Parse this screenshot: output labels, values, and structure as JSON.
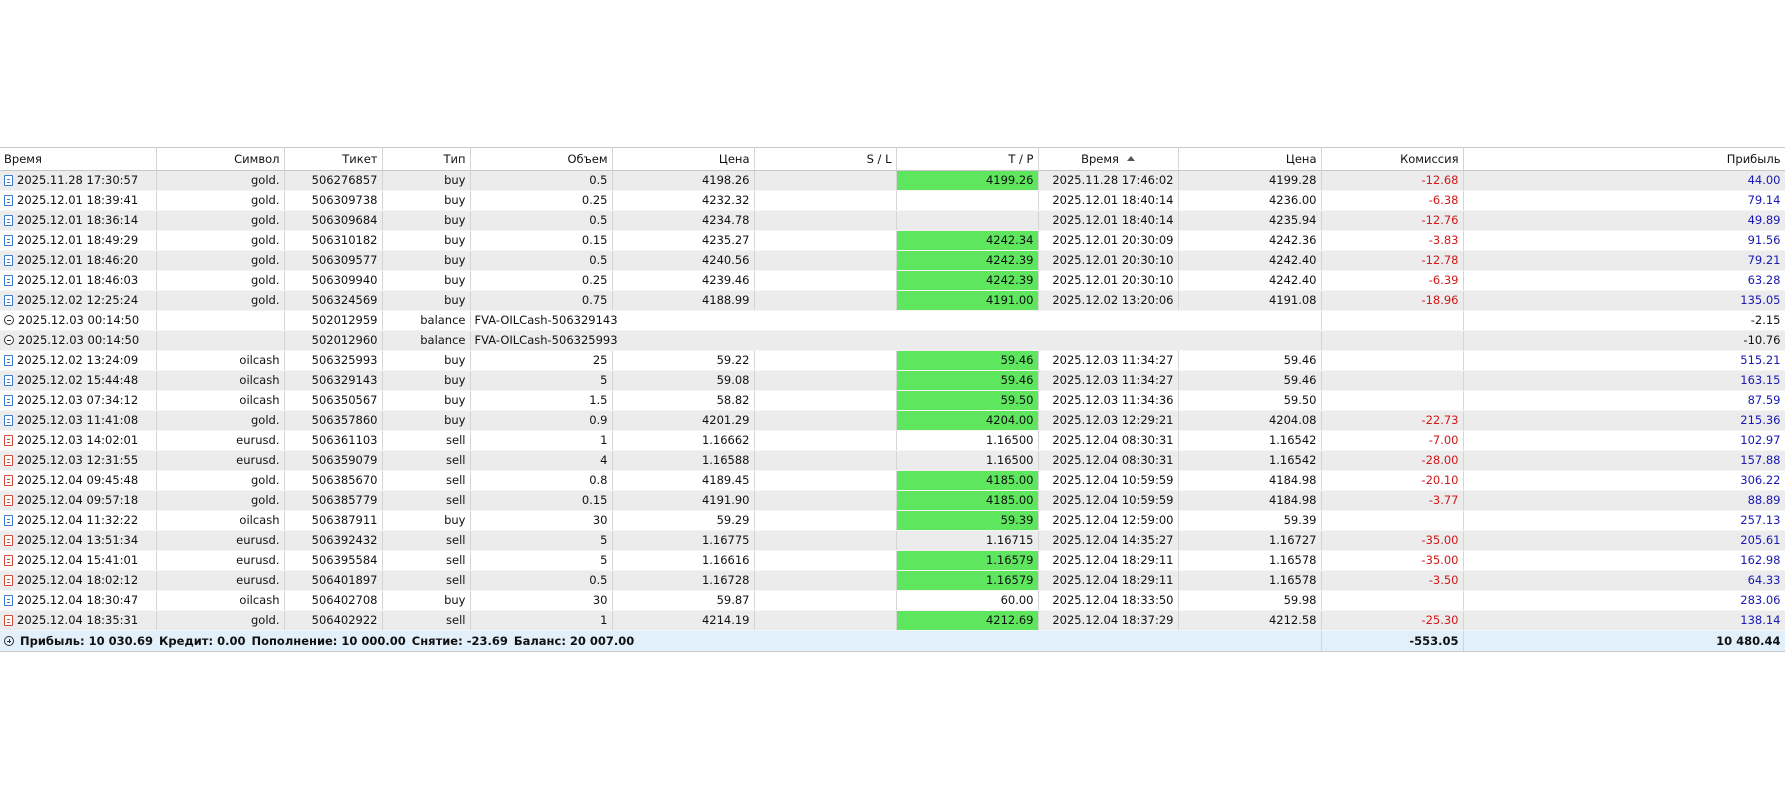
{
  "columns": [
    "Время",
    "Символ",
    "Тикет",
    "Тип",
    "Объем",
    "Цена",
    "S / L",
    "T / P",
    "Время",
    "Цена",
    "Комиссия",
    "Прибыль"
  ],
  "rows": [
    {
      "kind": "buy",
      "open_time": "2025.11.28 17:30:57",
      "symbol": "gold.",
      "ticket": "506276857",
      "type": "buy",
      "volume": "0.5",
      "price": "4198.26",
      "sl": "",
      "tp": "4199.26",
      "tp_hit": true,
      "close_time": "2025.11.28 17:46:02",
      "close_price": "4199.28",
      "commission": "-12.68",
      "profit": "44.00"
    },
    {
      "kind": "buy",
      "open_time": "2025.12.01 18:39:41",
      "symbol": "gold.",
      "ticket": "506309738",
      "type": "buy",
      "volume": "0.25",
      "price": "4232.32",
      "sl": "",
      "tp": "",
      "tp_hit": false,
      "close_time": "2025.12.01 18:40:14",
      "close_price": "4236.00",
      "commission": "-6.38",
      "profit": "79.14"
    },
    {
      "kind": "buy",
      "open_time": "2025.12.01 18:36:14",
      "symbol": "gold.",
      "ticket": "506309684",
      "type": "buy",
      "volume": "0.5",
      "price": "4234.78",
      "sl": "",
      "tp": "",
      "tp_hit": false,
      "close_time": "2025.12.01 18:40:14",
      "close_price": "4235.94",
      "commission": "-12.76",
      "profit": "49.89"
    },
    {
      "kind": "buy",
      "open_time": "2025.12.01 18:49:29",
      "symbol": "gold.",
      "ticket": "506310182",
      "type": "buy",
      "volume": "0.15",
      "price": "4235.27",
      "sl": "",
      "tp": "4242.34",
      "tp_hit": true,
      "close_time": "2025.12.01 20:30:09",
      "close_price": "4242.36",
      "commission": "-3.83",
      "profit": "91.56"
    },
    {
      "kind": "buy",
      "open_time": "2025.12.01 18:46:20",
      "symbol": "gold.",
      "ticket": "506309577",
      "type": "buy",
      "volume": "0.5",
      "price": "4240.56",
      "sl": "",
      "tp": "4242.39",
      "tp_hit": true,
      "close_time": "2025.12.01 20:30:10",
      "close_price": "4242.40",
      "commission": "-12.78",
      "profit": "79.21"
    },
    {
      "kind": "buy",
      "open_time": "2025.12.01 18:46:03",
      "symbol": "gold.",
      "ticket": "506309940",
      "type": "buy",
      "volume": "0.25",
      "price": "4239.46",
      "sl": "",
      "tp": "4242.39",
      "tp_hit": true,
      "close_time": "2025.12.01 20:30:10",
      "close_price": "4242.40",
      "commission": "-6.39",
      "profit": "63.28"
    },
    {
      "kind": "buy",
      "open_time": "2025.12.02 12:25:24",
      "symbol": "gold.",
      "ticket": "506324569",
      "type": "buy",
      "volume": "0.75",
      "price": "4188.99",
      "sl": "",
      "tp": "4191.00",
      "tp_hit": true,
      "close_time": "2025.12.02 13:20:06",
      "close_price": "4191.08",
      "commission": "-18.96",
      "profit": "135.05"
    },
    {
      "kind": "balance",
      "open_time": "2025.12.03 00:14:50",
      "symbol": "",
      "ticket": "502012959",
      "type": "balance",
      "comment": "FVA-OILCash-506329143",
      "commission": "",
      "profit": "-2.15"
    },
    {
      "kind": "balance",
      "open_time": "2025.12.03 00:14:50",
      "symbol": "",
      "ticket": "502012960",
      "type": "balance",
      "comment": "FVA-OILCash-506325993",
      "commission": "",
      "profit": "-10.76"
    },
    {
      "kind": "buy",
      "open_time": "2025.12.02 13:24:09",
      "symbol": "oilcash",
      "ticket": "506325993",
      "type": "buy",
      "volume": "25",
      "price": "59.22",
      "sl": "",
      "tp": "59.46",
      "tp_hit": true,
      "close_time": "2025.12.03 11:34:27",
      "close_price": "59.46",
      "commission": "",
      "profit": "515.21"
    },
    {
      "kind": "buy",
      "open_time": "2025.12.02 15:44:48",
      "symbol": "oilcash",
      "ticket": "506329143",
      "type": "buy",
      "volume": "5",
      "price": "59.08",
      "sl": "",
      "tp": "59.46",
      "tp_hit": true,
      "close_time": "2025.12.03 11:34:27",
      "close_price": "59.46",
      "commission": "",
      "profit": "163.15"
    },
    {
      "kind": "buy",
      "open_time": "2025.12.03 07:34:12",
      "symbol": "oilcash",
      "ticket": "506350567",
      "type": "buy",
      "volume": "1.5",
      "price": "58.82",
      "sl": "",
      "tp": "59.50",
      "tp_hit": true,
      "close_time": "2025.12.03 11:34:36",
      "close_price": "59.50",
      "commission": "",
      "profit": "87.59"
    },
    {
      "kind": "buy",
      "open_time": "2025.12.03 11:41:08",
      "symbol": "gold.",
      "ticket": "506357860",
      "type": "buy",
      "volume": "0.9",
      "price": "4201.29",
      "sl": "",
      "tp": "4204.00",
      "tp_hit": true,
      "close_time": "2025.12.03 12:29:21",
      "close_price": "4204.08",
      "commission": "-22.73",
      "profit": "215.36"
    },
    {
      "kind": "sell",
      "open_time": "2025.12.03 14:02:01",
      "symbol": "eurusd.",
      "ticket": "506361103",
      "type": "sell",
      "volume": "1",
      "price": "1.16662",
      "sl": "",
      "tp": "1.16500",
      "tp_hit": false,
      "close_time": "2025.12.04 08:30:31",
      "close_price": "1.16542",
      "commission": "-7.00",
      "profit": "102.97"
    },
    {
      "kind": "sell",
      "open_time": "2025.12.03 12:31:55",
      "symbol": "eurusd.",
      "ticket": "506359079",
      "type": "sell",
      "volume": "4",
      "price": "1.16588",
      "sl": "",
      "tp": "1.16500",
      "tp_hit": false,
      "close_time": "2025.12.04 08:30:31",
      "close_price": "1.16542",
      "commission": "-28.00",
      "profit": "157.88"
    },
    {
      "kind": "sell",
      "open_time": "2025.12.04 09:45:48",
      "symbol": "gold.",
      "ticket": "506385670",
      "type": "sell",
      "volume": "0.8",
      "price": "4189.45",
      "sl": "",
      "tp": "4185.00",
      "tp_hit": true,
      "close_time": "2025.12.04 10:59:59",
      "close_price": "4184.98",
      "commission": "-20.10",
      "profit": "306.22"
    },
    {
      "kind": "sell",
      "open_time": "2025.12.04 09:57:18",
      "symbol": "gold.",
      "ticket": "506385779",
      "type": "sell",
      "volume": "0.15",
      "price": "4191.90",
      "sl": "",
      "tp": "4185.00",
      "tp_hit": true,
      "close_time": "2025.12.04 10:59:59",
      "close_price": "4184.98",
      "commission": "-3.77",
      "profit": "88.89"
    },
    {
      "kind": "buy",
      "open_time": "2025.12.04 11:32:22",
      "symbol": "oilcash",
      "ticket": "506387911",
      "type": "buy",
      "volume": "30",
      "price": "59.29",
      "sl": "",
      "tp": "59.39",
      "tp_hit": true,
      "close_time": "2025.12.04 12:59:00",
      "close_price": "59.39",
      "commission": "",
      "profit": "257.13"
    },
    {
      "kind": "sell",
      "open_time": "2025.12.04 13:51:34",
      "symbol": "eurusd.",
      "ticket": "506392432",
      "type": "sell",
      "volume": "5",
      "price": "1.16775",
      "sl": "",
      "tp": "1.16715",
      "tp_hit": false,
      "close_time": "2025.12.04 14:35:27",
      "close_price": "1.16727",
      "commission": "-35.00",
      "profit": "205.61"
    },
    {
      "kind": "sell",
      "open_time": "2025.12.04 15:41:01",
      "symbol": "eurusd.",
      "ticket": "506395584",
      "type": "sell",
      "volume": "5",
      "price": "1.16616",
      "sl": "",
      "tp": "1.16579",
      "tp_hit": true,
      "close_time": "2025.12.04 18:29:11",
      "close_price": "1.16578",
      "commission": "-35.00",
      "profit": "162.98"
    },
    {
      "kind": "sell",
      "open_time": "2025.12.04 18:02:12",
      "symbol": "eurusd.",
      "ticket": "506401897",
      "type": "sell",
      "volume": "0.5",
      "price": "1.16728",
      "sl": "",
      "tp": "1.16579",
      "tp_hit": true,
      "close_time": "2025.12.04 18:29:11",
      "close_price": "1.16578",
      "commission": "-3.50",
      "profit": "64.33"
    },
    {
      "kind": "buy",
      "open_time": "2025.12.04 18:30:47",
      "symbol": "oilcash",
      "ticket": "506402708",
      "type": "buy",
      "volume": "30",
      "price": "59.87",
      "sl": "",
      "tp": "60.00",
      "tp_hit": false,
      "close_time": "2025.12.04 18:33:50",
      "close_price": "59.98",
      "commission": "",
      "profit": "283.06"
    },
    {
      "kind": "sell",
      "open_time": "2025.12.04 18:35:31",
      "symbol": "gold.",
      "ticket": "506402922",
      "type": "sell",
      "volume": "1",
      "price": "4214.19",
      "sl": "",
      "tp": "4212.69",
      "tp_hit": true,
      "close_time": "2025.12.04 18:37:29",
      "close_price": "4212.58",
      "commission": "-25.30",
      "profit": "138.14"
    }
  ],
  "summary": {
    "profit": "Прибыль: 10 030.69",
    "credit": "Кредит: 0.00",
    "deposit": "Пополнение: 10 000.00",
    "withdrawal": "Снятие: -23.69",
    "balance": "Баланс: 20 007.00",
    "total_commission": "-553.05",
    "total_profit": "10 480.44"
  },
  "colors": {
    "tp_hit": "#5ee65e",
    "negative": "#d01818",
    "positive": "#1818b4",
    "summary_bg": "#e2f0fb"
  }
}
